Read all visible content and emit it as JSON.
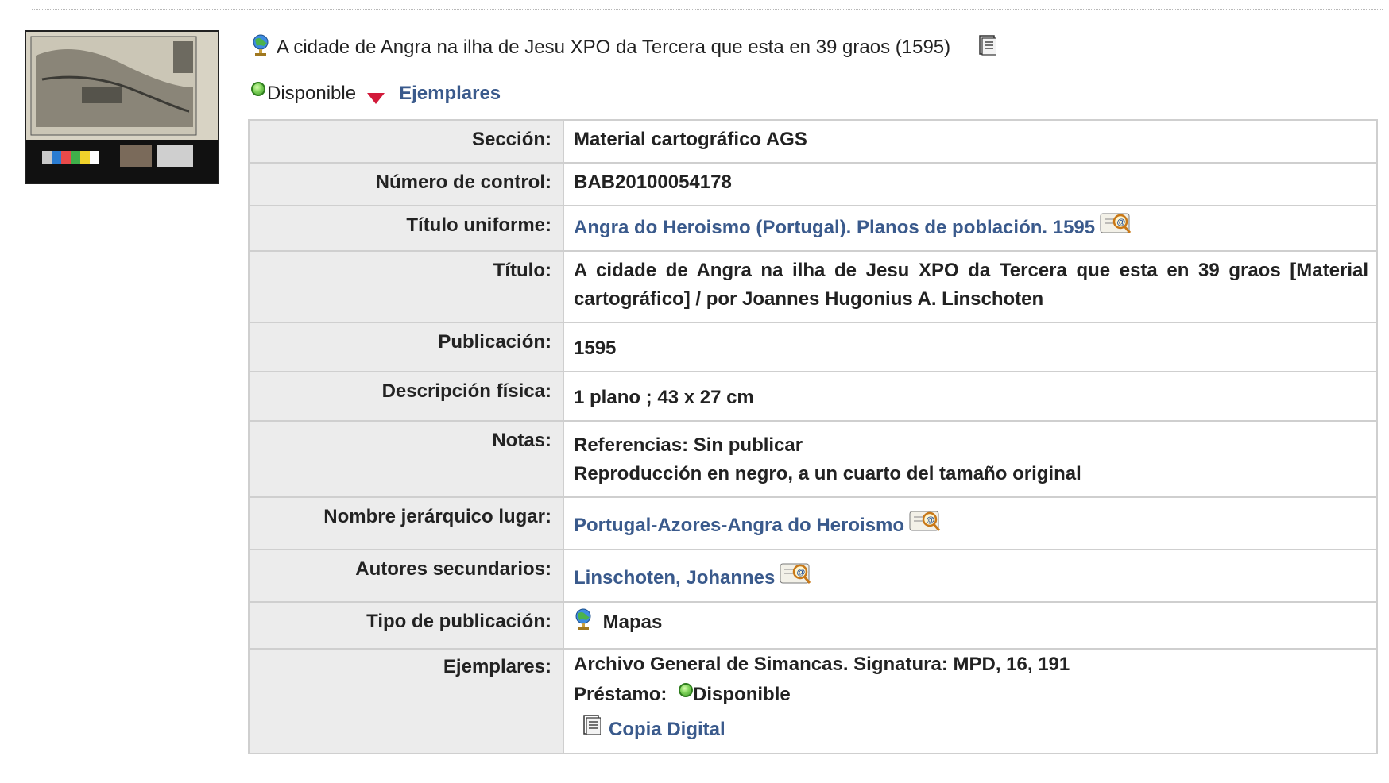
{
  "record": {
    "title": "A cidade de Angra na ilha de Jesu XPO da Tercera que esta en 39 graos (1595)",
    "status": "Disponible",
    "copies_link": "Ejemplares"
  },
  "fields": {
    "seccion": {
      "label": "Sección:",
      "value": "Material cartográfico AGS"
    },
    "control": {
      "label": "Número de control:",
      "value": "BAB20100054178"
    },
    "uniforme": {
      "label": "Título uniforme:",
      "value": "Angra do Heroismo (Portugal). Planos de población. 1595"
    },
    "titulo": {
      "label": "Título:",
      "value": "A cidade de Angra na ilha de Jesu XPO da Tercera que esta en 39 graos [Material cartográfico] / por Joannes Hugonius A. Linschoten"
    },
    "publicacion": {
      "label": "Publicación:",
      "value": "1595"
    },
    "descripcion": {
      "label": "Descripción física:",
      "value": "1 plano ; 43 x 27 cm"
    },
    "notas": {
      "label": "Notas:",
      "line1": "Referencias: Sin publicar",
      "line2": "Reproducción en negro, a un cuarto del tamaño original"
    },
    "lugar": {
      "label": "Nombre jerárquico lugar:",
      "value": "Portugal-Azores-Angra do Heroismo"
    },
    "autores": {
      "label": "Autores secundarios:",
      "value": "Linschoten, Johannes"
    },
    "tipo": {
      "label": "Tipo de publicación:",
      "value": "Mapas"
    },
    "ejemplares": {
      "label": "Ejemplares:",
      "archive": "Archivo General de Simancas. Signatura: MPD, 16, 191",
      "loan_label": "Préstamo:",
      "loan_status": "Disponible",
      "digital_copy": "Copia Digital"
    }
  },
  "icons": [
    "globe-icon",
    "document-icon",
    "green-status-icon",
    "red-arrow-icon",
    "search-catalog-icon"
  ],
  "colors": {
    "link": "#3a5a8c",
    "label_bg": "#ececec",
    "border": "#cfcfcf",
    "arrow": "#d21a3a"
  }
}
